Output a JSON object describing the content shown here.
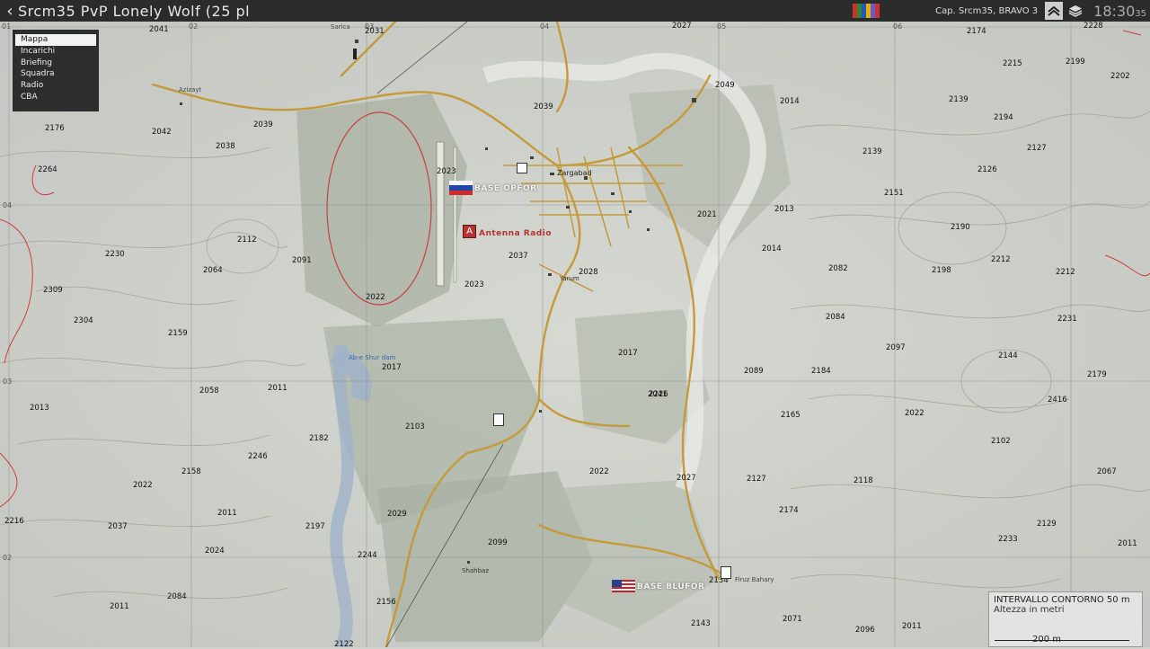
{
  "topbar": {
    "back_glyph": "‹",
    "title": "Srcm35 PvP Lonely Wolf (25 pl",
    "player": "Cap. Srcm35, BRAVO 3",
    "clock": "18:30",
    "clock_seconds": "35",
    "flag_colors": [
      "#c83232",
      "#2d8a2d",
      "#2a52be",
      "#e0b400",
      "#6a5acd",
      "#c83232"
    ]
  },
  "menu": {
    "items": [
      "Mappa",
      "Incarichi",
      "Briefing",
      "Squadra",
      "Radio",
      "CBA"
    ],
    "active": "Mappa"
  },
  "map": {
    "places": [
      "Sarica",
      "Azizayt",
      "Zargabad",
      "Yarum",
      "Ab-e Shur dam",
      "Shahbaz",
      "Firuz Bahary"
    ],
    "markers": {
      "opfor": "BASE OPFOR",
      "antenna": "Antenna Radio",
      "blufor": "BASE BLUFOR"
    },
    "grid_top": [
      "01",
      "02",
      "03",
      "04",
      "05",
      "06"
    ],
    "grid_left": [
      "04",
      "03",
      "02"
    ],
    "elevations": [
      "2041",
      "2031",
      "2027",
      "2174",
      "2228",
      "2160",
      "2215",
      "2199",
      "2202",
      "2049",
      "2039",
      "2014",
      "2139",
      "2176",
      "2042",
      "2038",
      "2039",
      "2194",
      "2127",
      "2264",
      "2139",
      "2126",
      "2023",
      "2151",
      "2013",
      "2021",
      "2190",
      "2112",
      "2230",
      "2014",
      "2212",
      "2064",
      "2091",
      "2037",
      "2028",
      "2082",
      "2198",
      "2212",
      "2309",
      "2022",
      "2023",
      "2084",
      "2231",
      "2304",
      "2159",
      "2017",
      "2097",
      "2144",
      "2017",
      "2041",
      "2089",
      "2184",
      "2179",
      "2058",
      "2011",
      "2226",
      "2416",
      "2013",
      "2103",
      "2165",
      "2022",
      "2182",
      "2246",
      "2102",
      "2158",
      "2022",
      "2022",
      "2027",
      "2127",
      "2118",
      "2067",
      "2011",
      "2029",
      "2174",
      "2216",
      "2037",
      "2197",
      "2129",
      "2024",
      "2099",
      "2233",
      "2011",
      "2244",
      "2084",
      "2134",
      "2011",
      "2156",
      "2071",
      "2143",
      "2096",
      "2011",
      "2122"
    ]
  },
  "legend": {
    "title": "INTERVALLO CONTORNO 50 m",
    "subtitle": "Altezza in metri",
    "scale": "200 m"
  }
}
